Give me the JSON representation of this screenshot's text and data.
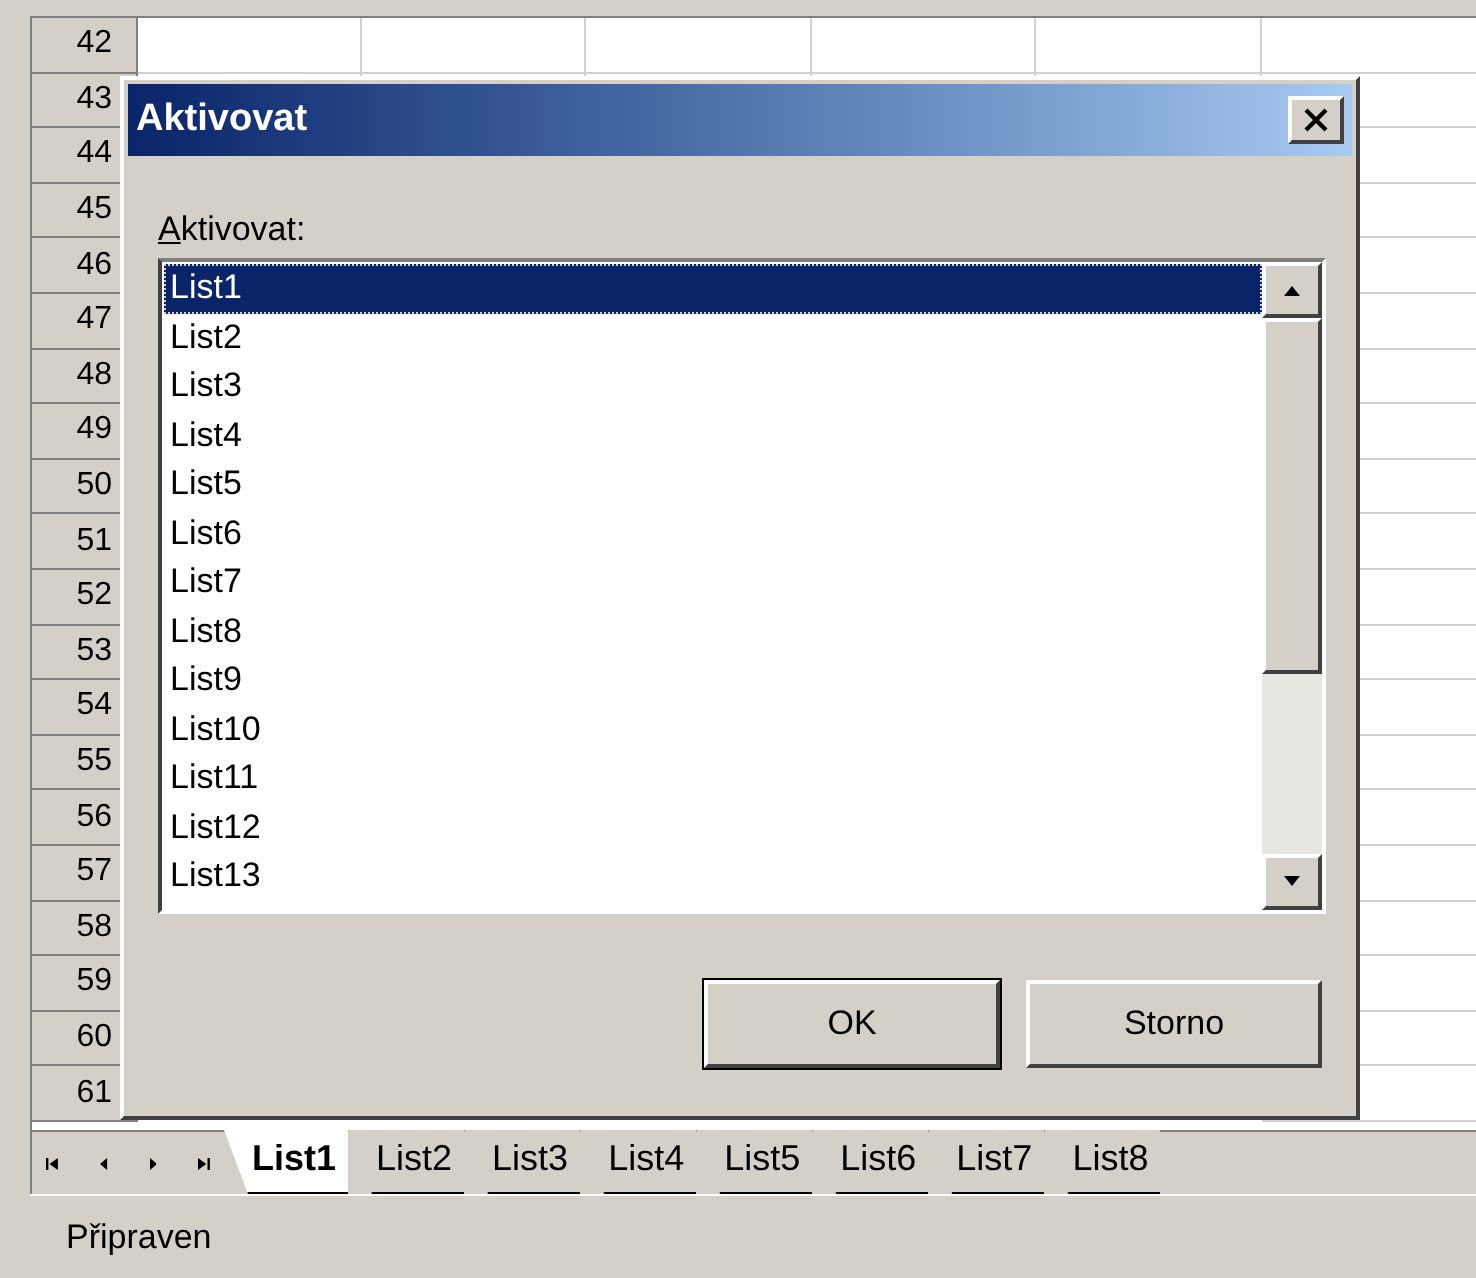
{
  "row_headers": [
    "42",
    "43",
    "44",
    "45",
    "46",
    "47",
    "48",
    "49",
    "50",
    "51",
    "52",
    "53",
    "54",
    "55",
    "56",
    "57",
    "58",
    "59",
    "60",
    "61"
  ],
  "dialog": {
    "title": "Aktivovat",
    "label": "Aktivovat:",
    "items": [
      {
        "label": "List1",
        "selected": true
      },
      {
        "label": "List2",
        "selected": false
      },
      {
        "label": "List3",
        "selected": false
      },
      {
        "label": "List4",
        "selected": false
      },
      {
        "label": "List5",
        "selected": false
      },
      {
        "label": "List6",
        "selected": false
      },
      {
        "label": "List7",
        "selected": false
      },
      {
        "label": "List8",
        "selected": false
      },
      {
        "label": "List9",
        "selected": false
      },
      {
        "label": "List10",
        "selected": false
      },
      {
        "label": "List11",
        "selected": false
      },
      {
        "label": "List12",
        "selected": false
      },
      {
        "label": "List13",
        "selected": false
      }
    ],
    "buttons": [
      "OK",
      "Storno"
    ]
  },
  "sheet_tabs": [
    {
      "label": "List1",
      "selected": true
    },
    {
      "label": "List2",
      "selected": false
    },
    {
      "label": "List3",
      "selected": false
    },
    {
      "label": "List4",
      "selected": false
    },
    {
      "label": "List5",
      "selected": false
    },
    {
      "label": "List6",
      "selected": false
    },
    {
      "label": "List7",
      "selected": false
    },
    {
      "label": "List8",
      "selected": false
    }
  ],
  "status_bar": "Připraven"
}
